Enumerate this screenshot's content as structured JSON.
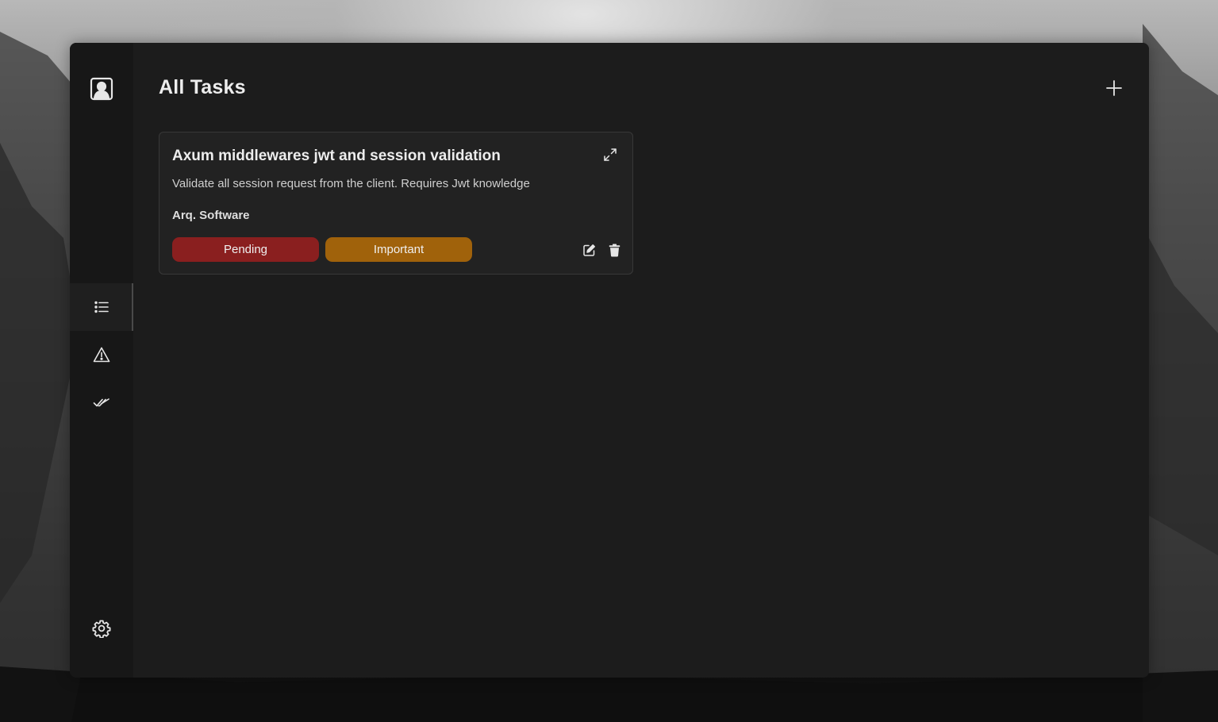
{
  "page": {
    "title": "All Tasks"
  },
  "sidebar": {
    "profile_icon": "user-square-icon",
    "nav": [
      {
        "id": "all",
        "icon": "list-icon",
        "active": true
      },
      {
        "id": "important",
        "icon": "warning-triangle-icon",
        "active": false
      },
      {
        "id": "completed",
        "icon": "double-check-icon",
        "active": false
      }
    ],
    "settings_icon": "gear-icon"
  },
  "header": {
    "add_icon": "plus-icon"
  },
  "tasks": [
    {
      "title": "Axum middlewares jwt and session validation",
      "description": "Validate all session request from the client. Requires Jwt knowledge",
      "category": "Arq. Software",
      "status": "Pending",
      "priority": "Important",
      "expand_icon": "expand-icon",
      "edit_icon": "edit-icon",
      "delete_icon": "trash-icon"
    }
  ],
  "colors": {
    "window_bg": "#1c1c1c",
    "sidebar_bg": "#171717",
    "card_bg": "#222222",
    "status_pending": "#8a1f1f",
    "priority_important": "#a0620b",
    "text_primary": "#ededed"
  }
}
